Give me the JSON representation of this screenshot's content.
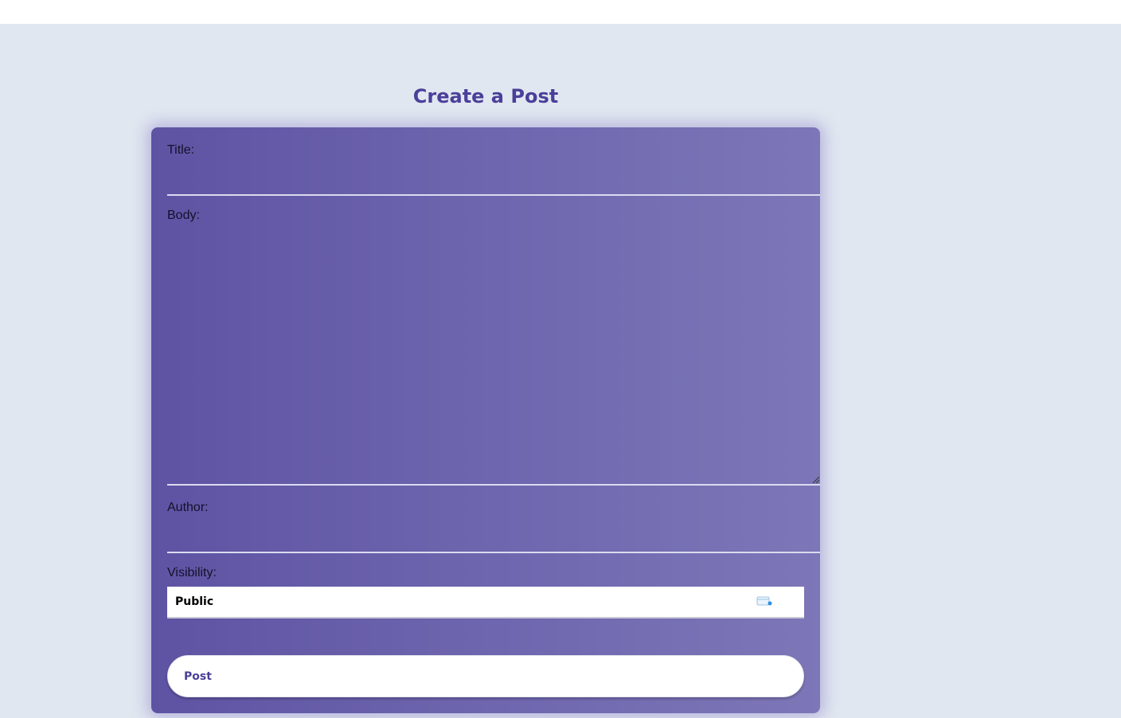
{
  "page": {
    "title": "Create a Post"
  },
  "form": {
    "title_label": "Title:",
    "title_value": "",
    "body_label": "Body:",
    "body_value": "",
    "author_label": "Author:",
    "author_value": "",
    "visibility_label": "Visibility:",
    "visibility_selected": "Public",
    "submit_label": "Post"
  },
  "colors": {
    "background": "#e1e7f0",
    "card_gradient_start": "#5e53a3",
    "card_gradient_end": "#7d77b8",
    "accent": "#4a3f9a",
    "input_underline": "#d9dcef"
  },
  "icons": {
    "select_icon": "autofill-card-icon",
    "resize_grip": "resize-grip-icon"
  }
}
